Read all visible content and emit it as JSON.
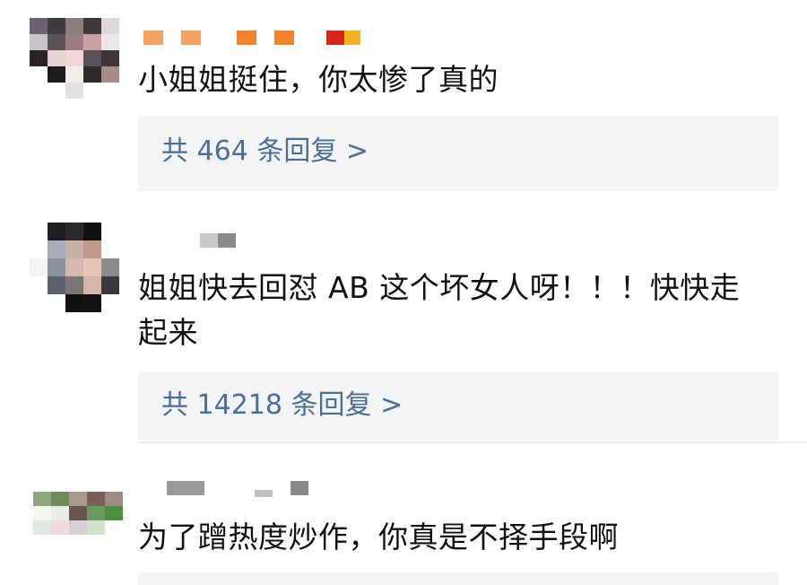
{
  "comments": [
    {
      "text": "小姐姐挺住，你太惨了真的",
      "replies_label": "共 464 条回复 >",
      "username_colors": [
        "#f5a25e",
        "#f5a25e",
        "#f3812b",
        "#f3812b",
        "#d9261c",
        "#f3b21f"
      ],
      "avatar_colors": [
        "#6a6470",
        "#3f3a3e",
        "#8a7f7e",
        "#3f3a3e",
        "#ddd8dc",
        "#c9c2c6",
        "#5a5256",
        "#9a7d80",
        "#caa0a5",
        "#ece6ea",
        "#2a2426",
        "#e7d3d3",
        "#f1d6da",
        "#5a5256",
        "#3d3536",
        "#ffffff",
        "#1d1b1c",
        "#f4eceb",
        "#2e2a2b",
        "#a88c8a",
        "#ffffff",
        "#ffffff",
        "#e4dfe3",
        "#ffffff",
        "#ffffff"
      ]
    },
    {
      "text": "姐姐快去回怼 AB 这个坏女人呀！！！快快走起来",
      "replies_label": "共 14218 条回复 >",
      "username_colors": [
        "#c8c8c8",
        "#8a8a8a"
      ],
      "avatar_colors": [
        "#ffffff",
        "#1e1e1e",
        "#2a2a2a",
        "#111111",
        "#ffffff",
        "#ffffff",
        "#a9adbb",
        "#c8b2a6",
        "#c2998b",
        "#ffffff",
        "#f3f3f3",
        "#8a90a0",
        "#d5b9ad",
        "#e6c5b6",
        "#8c8a8a",
        "#ffffff",
        "#5b6170",
        "#7b7575",
        "#d4b5a7",
        "#3a3a3a",
        "#ffffff",
        "#ffffff",
        "#111111",
        "#141414",
        "#ffffff"
      ]
    },
    {
      "text": "为了蹭热度炒作，你真是不择手段啊",
      "replies_label": "",
      "username_colors": [
        "#9a9a9a",
        "#c0c0c0",
        "#8a8a8a"
      ],
      "avatar_colors": [
        "#8fa67e",
        "#6f8b5c",
        "#a8998f",
        "#7a5f5f",
        "#9d8b88",
        "#f4f6f2",
        "#e9ede4",
        "#69564f",
        "#6a9a5e",
        "#4b8f3e",
        "#e1e8df",
        "#f1d9de",
        "#d8cfd6",
        "#cfe3c9",
        "#ffffff",
        "#ffffff",
        "#ffffff",
        "#ffffff",
        "#ffffff",
        "#ffffff",
        "#ffffff",
        "#ffffff",
        "#ffffff",
        "#ffffff",
        "#ffffff"
      ]
    }
  ]
}
